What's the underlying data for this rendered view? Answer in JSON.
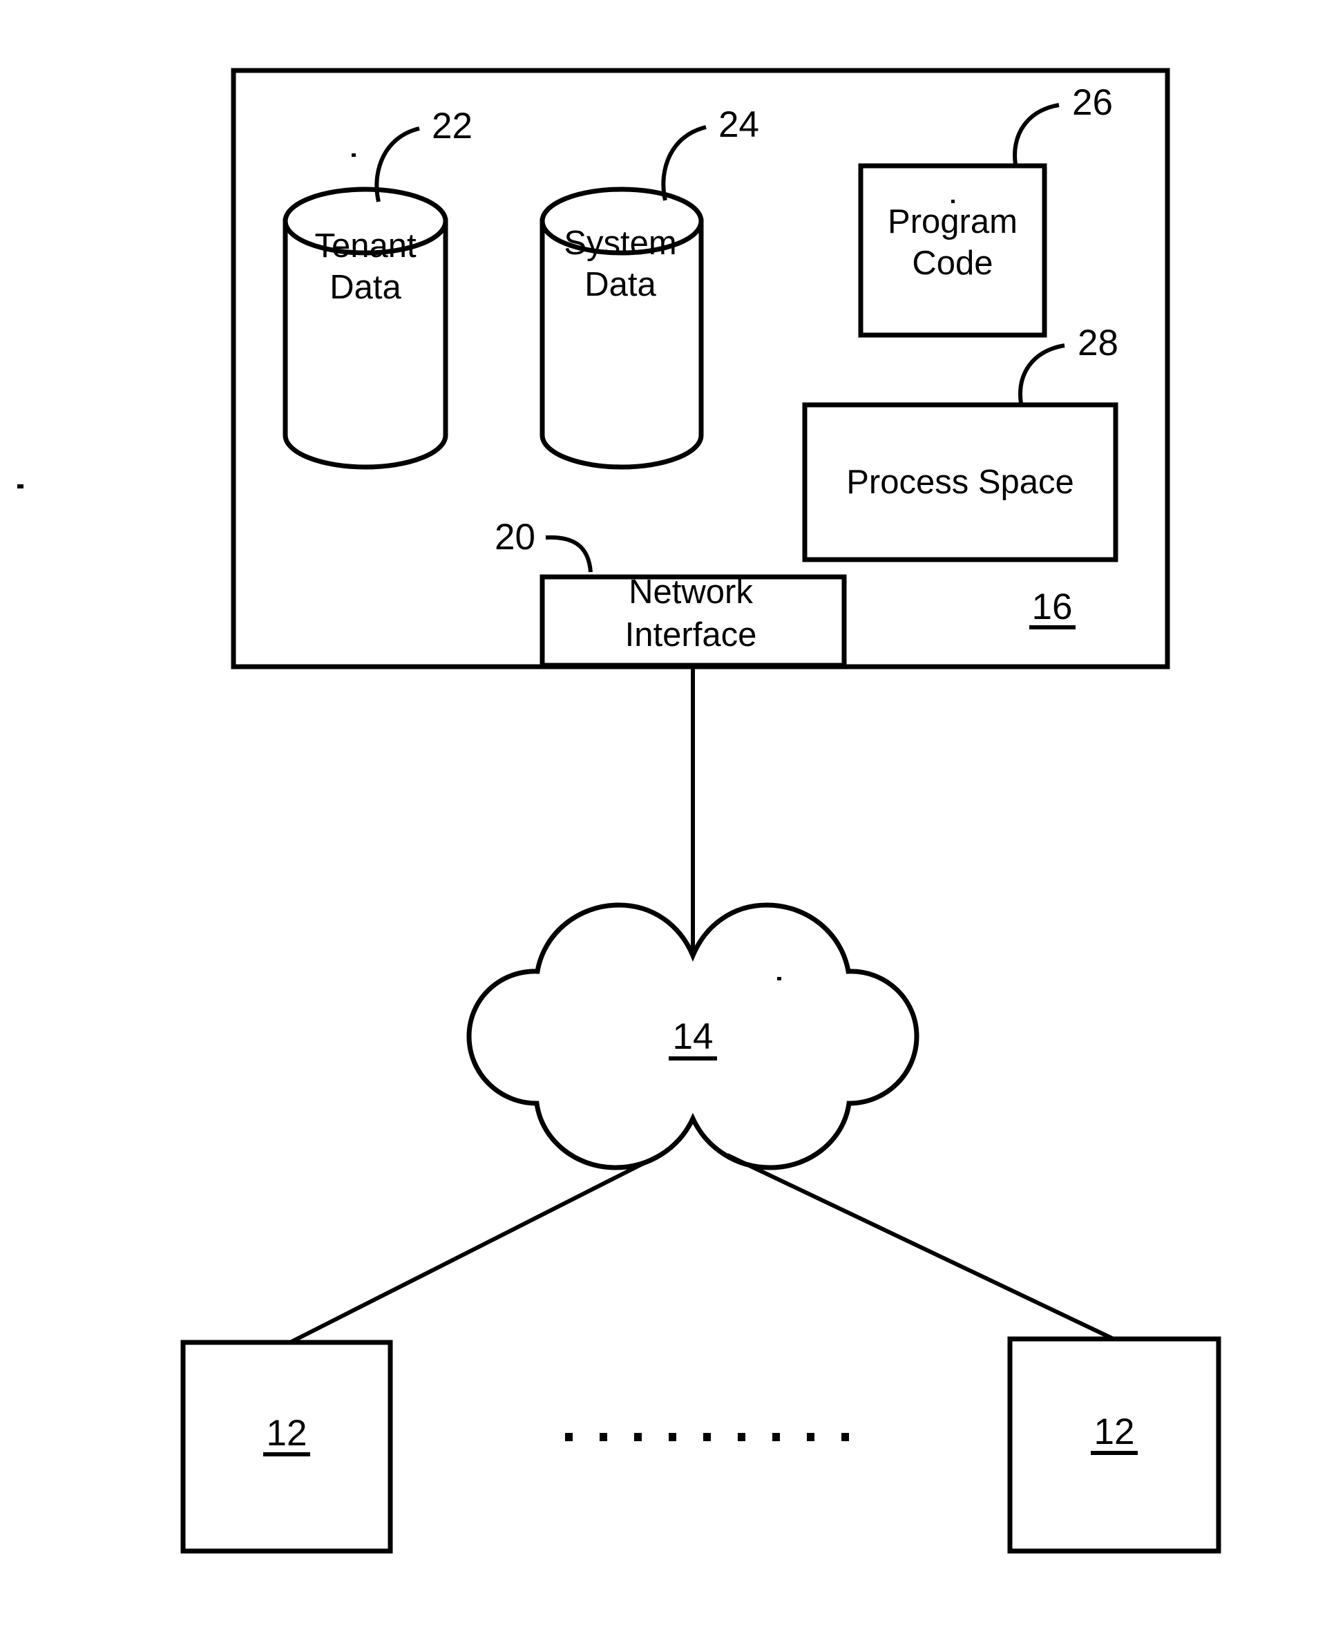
{
  "figure": {
    "type": "patent-block-diagram",
    "background_color": "#ffffff",
    "line_color": "#000000"
  },
  "server": {
    "reference_numeral": "16",
    "tenant_db": {
      "reference_numeral": "22",
      "line1": "Tenant",
      "line2": "Data"
    },
    "system_db": {
      "reference_numeral": "24",
      "line1": "System",
      "line2": "Data"
    },
    "program_code": {
      "reference_numeral": "26",
      "line1": "Program",
      "line2": "Code"
    },
    "process_space": {
      "reference_numeral": "28",
      "label": "Process Space"
    },
    "network_interface": {
      "reference_numeral": "20",
      "line1": "Network",
      "line2": "Interface"
    }
  },
  "network_cloud": {
    "reference_numeral": "14"
  },
  "clients": {
    "left": {
      "reference_numeral": "12"
    },
    "right": {
      "reference_numeral": "12"
    },
    "ellipsis_dot_count": 9
  }
}
